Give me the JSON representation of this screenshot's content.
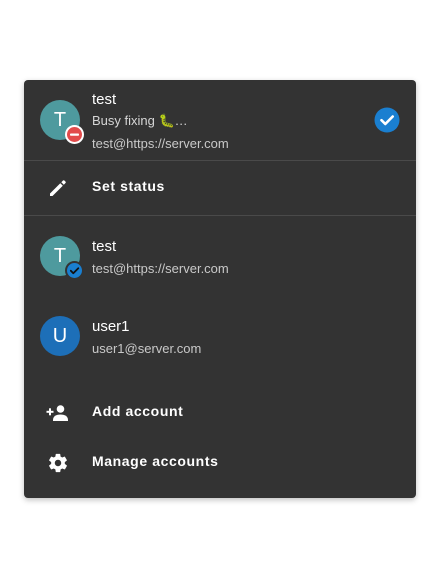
{
  "colors": {
    "panel": "#333333",
    "avatar_teal": "#4e9a9e",
    "avatar_blue": "#1d6fb8",
    "accent_blue": "#1a7fd0",
    "status_dnd": "#e24b4b"
  },
  "current_account": {
    "avatar_initial": "T",
    "name": "test",
    "status_message": "Busy fixing 🐛…",
    "address": "test@https://server.com",
    "status_icon": "do-not-disturb-icon",
    "selected_icon": "check-circle-icon"
  },
  "set_status": {
    "label": "Set status",
    "icon": "pencil-icon"
  },
  "accounts": [
    {
      "avatar_initial": "T",
      "name": "test",
      "address": "test@https://server.com",
      "badge_icon": "check-circle-icon"
    },
    {
      "avatar_initial": "U",
      "name": "user1",
      "address": "user1@server.com"
    }
  ],
  "actions": {
    "add_account": {
      "label": "Add account",
      "icon": "add-person-icon"
    },
    "manage_accounts": {
      "label": "Manage accounts",
      "icon": "gear-icon"
    }
  }
}
